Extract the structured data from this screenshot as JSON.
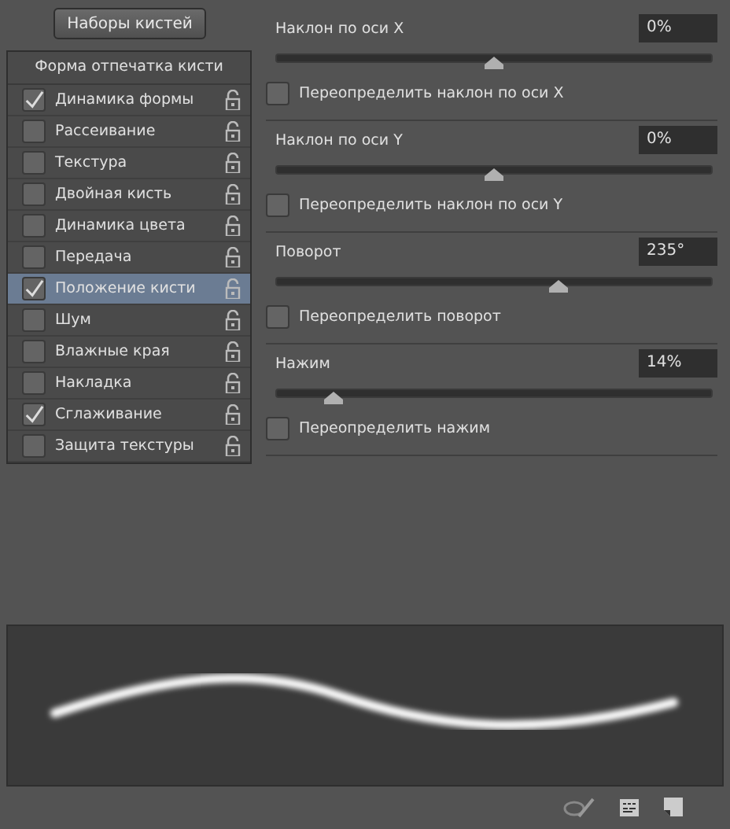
{
  "presets_button": "Наборы кистей",
  "brush_list": {
    "header": "Форма отпечатка кисти",
    "items": [
      {
        "label": "Динамика формы",
        "checked": true,
        "selected": false
      },
      {
        "label": "Рассеивание",
        "checked": false,
        "selected": false
      },
      {
        "label": "Текстура",
        "checked": false,
        "selected": false
      },
      {
        "label": "Двойная кисть",
        "checked": false,
        "selected": false
      },
      {
        "label": "Динамика цвета",
        "checked": false,
        "selected": false
      },
      {
        "label": "Передача",
        "checked": false,
        "selected": false
      },
      {
        "label": "Положение кисти",
        "checked": true,
        "selected": true
      },
      {
        "label": "Шум",
        "checked": false,
        "selected": false
      },
      {
        "label": "Влажные края",
        "checked": false,
        "selected": false
      },
      {
        "label": "Накладка",
        "checked": false,
        "selected": false
      },
      {
        "label": "Сглаживание",
        "checked": true,
        "selected": false
      },
      {
        "label": "Защита текстуры",
        "checked": false,
        "selected": false
      }
    ]
  },
  "settings": [
    {
      "label": "Наклон по оси X",
      "value": "0%",
      "level": 0.5,
      "override": "Переопределить наклон по оси X",
      "checked": false
    },
    {
      "label": "Наклон по оси Y",
      "value": "0%",
      "level": 0.5,
      "override": "Переопределить наклон по оси Y",
      "checked": false
    },
    {
      "label": "Поворот",
      "value": "235°",
      "level": 0.65,
      "override": "Переопределить поворот",
      "checked": false
    },
    {
      "label": "Нажим",
      "value": "14%",
      "level": 0.13,
      "override": "Переопределить нажим",
      "checked": false
    }
  ]
}
